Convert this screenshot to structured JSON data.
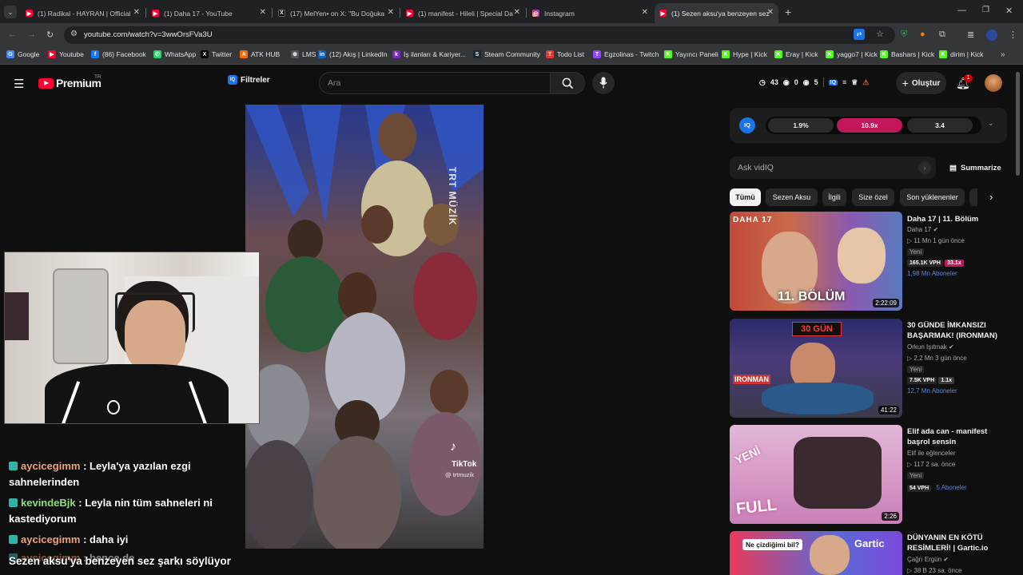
{
  "browser": {
    "tabs": [
      {
        "title": "(1) Radikal - HAYRAN | Official",
        "color": "#ff0033",
        "icon": "youtube-icon"
      },
      {
        "title": "(1) Daha 17 - YouTube",
        "color": "#ff0033",
        "icon": "youtube-icon"
      },
      {
        "title": "(17) MelYen• on X: \"Bu Doğuka",
        "color": "#000000",
        "icon": "x-icon"
      },
      {
        "title": "(1) manifest - Hileli | Special Da",
        "color": "#ff0033",
        "icon": "youtube-icon"
      },
      {
        "title": "Instagram",
        "color": "#d62976",
        "icon": "instagram-icon"
      },
      {
        "title": "(1) Sezen aksu'ya benzeyen sez",
        "color": "#ff0033",
        "icon": "youtube-icon"
      }
    ],
    "url": "youtube.com/watch?v=3wwOrsFVa3U",
    "bookmarks": [
      {
        "label": "Google",
        "color": "#4285f4",
        "glyph": "G"
      },
      {
        "label": "Youtube",
        "color": "#ff0033",
        "glyph": "▶"
      },
      {
        "label": "(86) Facebook",
        "color": "#1877f2",
        "glyph": "f"
      },
      {
        "label": "WhatsApp",
        "color": "#25d366",
        "glyph": "✆"
      },
      {
        "label": "Twitter",
        "color": "#000000",
        "glyph": "X"
      },
      {
        "label": "ATK HUB",
        "color": "#ff6a00",
        "glyph": "A"
      },
      {
        "label": "LMS",
        "color": "#555555",
        "glyph": "⊕"
      },
      {
        "label": "(12) Akış | LinkedIn",
        "color": "#0a66c2",
        "glyph": "in"
      },
      {
        "label": "İş ilanları & Kariyer...",
        "color": "#7b2cbf",
        "glyph": "k"
      },
      {
        "label": "Steam Community",
        "color": "#1b2838",
        "glyph": "S"
      },
      {
        "label": "Todo List",
        "color": "#e53935",
        "glyph": "T"
      },
      {
        "label": "Egzolinas - Twitch",
        "color": "#9146ff",
        "glyph": "T"
      },
      {
        "label": "Yayıncı Paneli",
        "color": "#53fc18",
        "glyph": "K"
      },
      {
        "label": "Hype | Kick",
        "color": "#53fc18",
        "glyph": "K"
      },
      {
        "label": "Eray | Kick",
        "color": "#53fc18",
        "glyph": "K"
      },
      {
        "label": "yaggo7 | Kick",
        "color": "#53fc18",
        "glyph": "K"
      },
      {
        "label": "Bashars | Kick",
        "color": "#53fc18",
        "glyph": "K"
      },
      {
        "label": "dirim | Kick",
        "color": "#53fc18",
        "glyph": "K"
      }
    ]
  },
  "youtube": {
    "logo": "Premium",
    "region": "TR",
    "filters_label": "Filtreler",
    "search_placeholder": "Ara",
    "stats": {
      "views": "43",
      "zero": "0",
      "five": "5"
    },
    "create_label": "Oluştur",
    "notification_count": "1"
  },
  "video": {
    "watermark": "TRT MÜZİK",
    "tiktok_label": "TikTok",
    "tiktok_handle": "@ trtmuzik"
  },
  "chat": [
    {
      "user": "aycicegimm",
      "user_color": "#f0a07a",
      "message": ": Leyla'ya yazılan ezgi sahnelerinden"
    },
    {
      "user": "kevindeBjk",
      "user_color": "#8be07a",
      "message": ": Leyla nin tüm sahneleri ni kastediyorum"
    },
    {
      "user": "aycicegimm",
      "user_color": "#f0a07a",
      "message": ": daha iyi"
    },
    {
      "user": "aycicegimm",
      "user_color": "#f0a07a",
      "message": ": bence de"
    }
  ],
  "subtitle": "Sezen aksu'ya benzeyen sez şarkı söylüyor",
  "vidiq": {
    "label": "IQ",
    "stat1": "1.9%",
    "stat2": "10.9x",
    "stat3": "3.4",
    "ask_placeholder": "Ask vidIQ",
    "summarize": "Summarize"
  },
  "chips": [
    "Tümü",
    "Sezen Aksu",
    "İlgili",
    "Size özel",
    "Son yüklenenler"
  ],
  "videos": [
    {
      "title": "Daha 17 | 11. Bölüm",
      "channel": "Daha 17",
      "stats": "11 Mn  1 gün önce",
      "badge": "Yeni",
      "vph": "165.1K VPH",
      "mult": "33.1x",
      "mult_color": "#c2185b",
      "subs": "1,98 Mn Aboneler",
      "duration": "2:22:09",
      "thumb_text": "11. BÖLÜM",
      "thumb_brand": "DAHA 17"
    },
    {
      "title": "30 GÜNDE İMKANSIZI BAŞARMAK! (IRONMAN)",
      "channel": "Orkun Işıtmak",
      "stats": "2,2 Mn  3 gün önce",
      "badge": "Yeni",
      "vph": "7.5K VPH",
      "mult": "1.1x",
      "mult_color": "#3a3a3a",
      "subs": "12,7 Mn Aboneler",
      "duration": "41:22",
      "thumb_text": "30 GÜN",
      "thumb_brand": "IRONMAN"
    },
    {
      "title": "Elif ada can - manifest başrol sensin",
      "channel": "Elif ile eğlenceler",
      "stats": "117  2 sa. önce",
      "badge": "Yeni",
      "vph": "54 VPH",
      "mult": "",
      "mult_color": "#3a3a3a",
      "subs": "5 Aboneler",
      "duration": "2:26",
      "thumb_text": "FULL",
      "thumb_brand": "YENİ"
    },
    {
      "title": "DÜNYANIN EN KÖTÜ RESİMLERİ! | Gartic.io",
      "channel": "Çağrı Ergün",
      "stats": "38 B  23 sa. önce",
      "badge": "",
      "vph": "",
      "mult": "",
      "mult_color": "#3a3a3a",
      "subs": "",
      "duration": "",
      "thumb_text": "Ne çizdiğimi bil?",
      "thumb_brand": "Gartic"
    }
  ]
}
